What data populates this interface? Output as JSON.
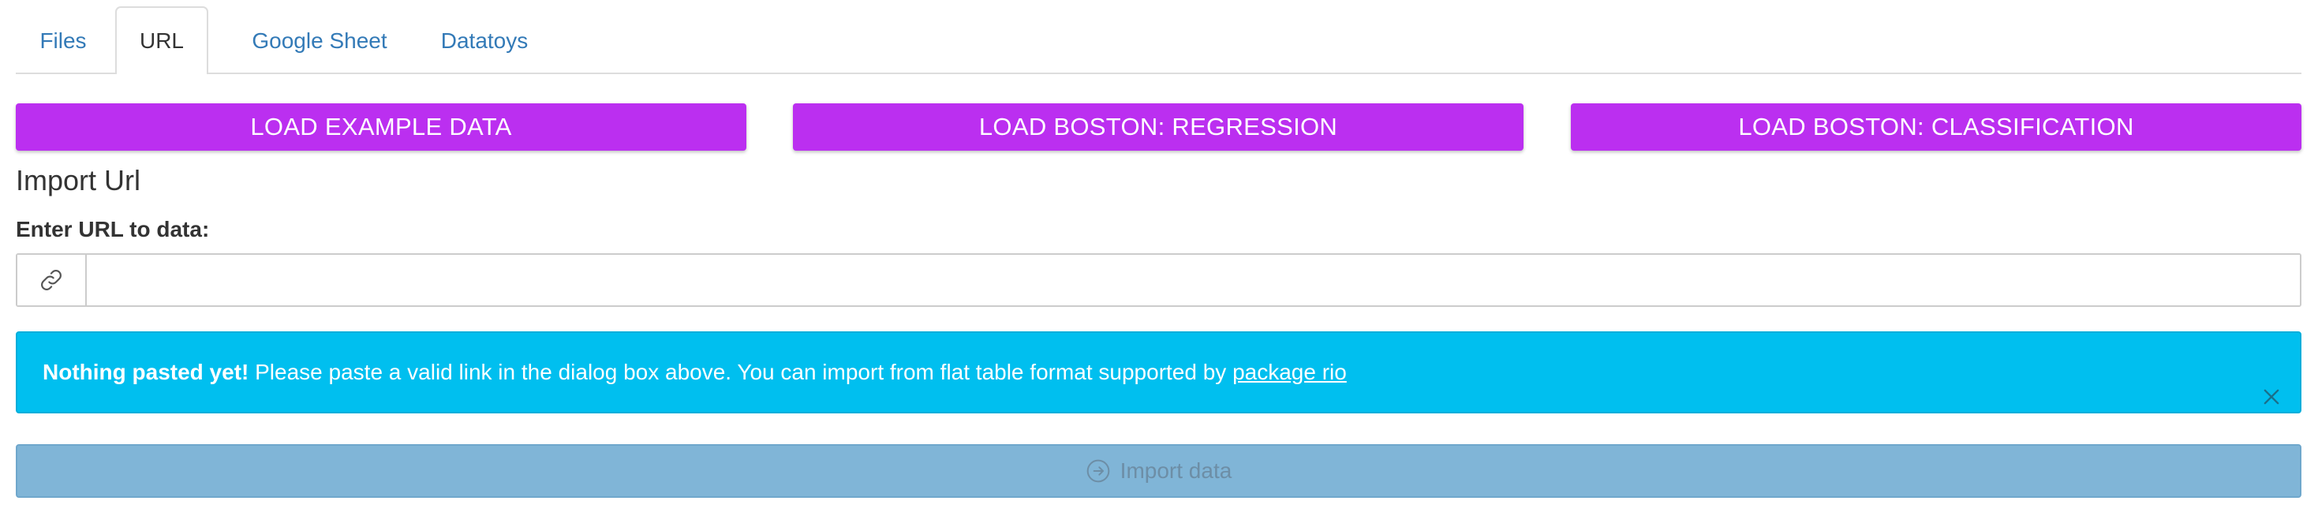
{
  "tabs": [
    {
      "label": "Files",
      "active": false
    },
    {
      "label": "URL",
      "active": true
    },
    {
      "label": "Google Sheet",
      "active": false
    },
    {
      "label": "Datatoys",
      "active": false
    }
  ],
  "example_buttons": {
    "example_data": "LOAD EXAMPLE DATA",
    "boston_regression": "LOAD BOSTON: REGRESSION",
    "boston_classification": "LOAD BOSTON: CLASSIFICATION"
  },
  "import_url": {
    "title": "Import Url",
    "field_label": "Enter URL to data:",
    "input_value": "",
    "input_placeholder": "",
    "link_icon": "link-icon"
  },
  "alert": {
    "strong_text": "Nothing pasted yet!",
    "message": "Please paste a valid link in the dialog box above. You can import from flat table format supported by",
    "link_text": "package rio",
    "close_icon": "close-icon"
  },
  "import_button": {
    "label": "Import data",
    "icon": "arrow-circle-right-icon",
    "disabled": true
  },
  "colors": {
    "accent_button": "#bb2ff0",
    "tab_link": "#337ab7",
    "alert_info": "#00bfef",
    "import_disabled": "#80b5d7"
  }
}
